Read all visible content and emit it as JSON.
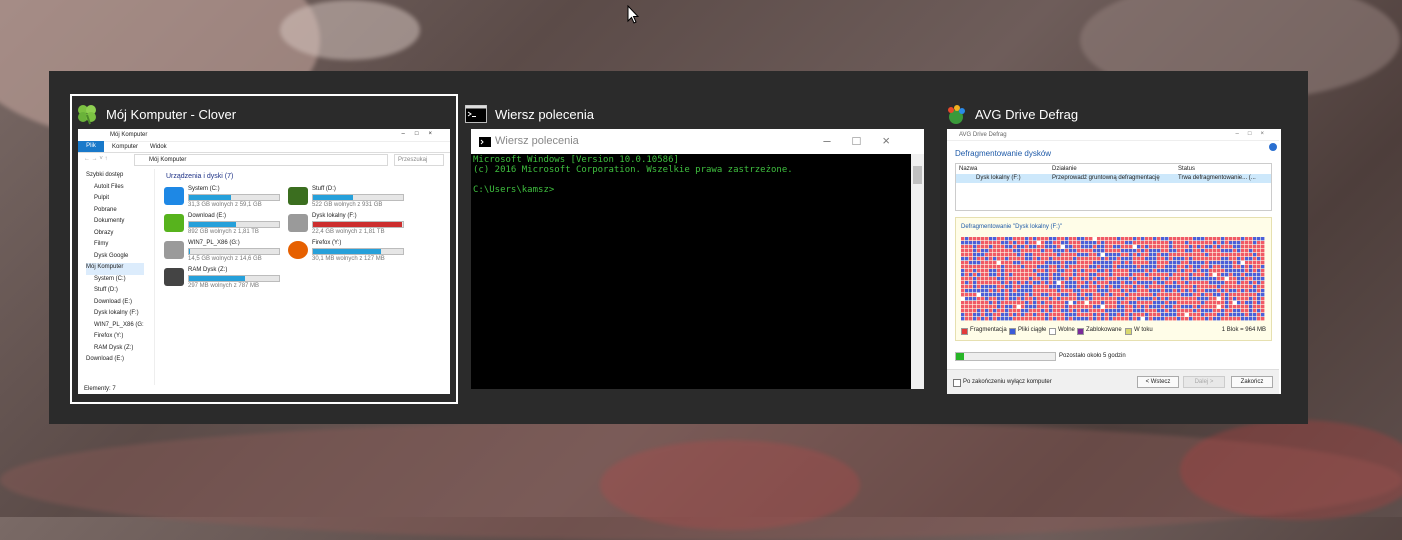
{
  "colors": {
    "accent": "#26a0da",
    "danger": "#cc2e2e",
    "console_text": "#3fbf3f",
    "panel": "#2b2b2b",
    "frag": "#f05a66",
    "contig": "#4c5fd8"
  },
  "windows": [
    {
      "title": "Mój Komputer - Clover",
      "icon": "clover-icon",
      "explorer": {
        "tab_title": "Mój Komputer",
        "ribbon": [
          "Plik",
          "Komputer",
          "Widok"
        ],
        "address": "Mój Komputer",
        "search_placeholder": "Przeszukaj",
        "section": "Urządzenia i dyski (7)",
        "nav": [
          "Szybki dostęp",
          "Autoit Files",
          "Pulpit",
          "Pobrane",
          "Dokumenty",
          "Obrazy",
          "Filmy",
          "Dysk Google",
          "Mój Komputer",
          "System (C:)",
          "Stuff (D:)",
          "Download (E:)",
          "Dysk lokalny (F:)",
          "WIN7_PL_X86 (G:",
          "Firefox (Y:)",
          "RAM Dysk (Z:)",
          "Download (E:)"
        ],
        "drives": [
          {
            "name": "System (C:)",
            "free": "31,3 GB wolnych z 59,1 GB",
            "fill": 0.47,
            "bar": "#26a0da",
            "icon": "windows-drive-icon"
          },
          {
            "name": "Stuff (D:)",
            "free": "522 GB wolnych z 931 GB",
            "fill": 0.44,
            "bar": "#26a0da",
            "icon": "leaf-drive-icon"
          },
          {
            "name": "Download (E:)",
            "free": "892 GB wolnych z 1,81 TB",
            "fill": 0.52,
            "bar": "#26a0da",
            "icon": "green-drive-icon"
          },
          {
            "name": "Dysk lokalny (F:)",
            "free": "22,4 GB wolnych z 1,81 TB",
            "fill": 0.99,
            "bar": "#cc2e2e",
            "icon": "hard-drive-icon"
          },
          {
            "name": "WIN7_PL_X86 (G:)",
            "free": "14,5 GB wolnych z 14,6 GB",
            "fill": 0.01,
            "bar": "#26a0da",
            "icon": "hard-drive-icon"
          },
          {
            "name": "Firefox (Y:)",
            "free": "30,1 MB wolnych z 127 MB",
            "fill": 0.76,
            "bar": "#26a0da",
            "icon": "firefox-icon"
          },
          {
            "name": "RAM Dysk (Z:)",
            "free": "297 MB wolnych z 787 MB",
            "fill": 0.62,
            "bar": "#26a0da",
            "icon": "ram-drive-icon"
          }
        ],
        "status": "Elementy: 7"
      }
    },
    {
      "title": "Wiersz polecenia",
      "icon": "cmd-icon",
      "console": {
        "window_title": "Wiersz polecenia",
        "lines": [
          "Microsoft Windows [Version 10.0.10586]",
          "(c) 2016 Microsoft Corporation. Wszelkie prawa zastrzeżone.",
          "",
          "C:\\Users\\kamsz>"
        ]
      }
    },
    {
      "title": "AVG Drive Defrag",
      "icon": "avg-icon",
      "avg": {
        "window_title": "AVG Drive Defrag",
        "heading": "Defragmentowanie dysków",
        "columns": [
          "Nazwa",
          "Działanie",
          "Status"
        ],
        "row": [
          "Dysk lokalny (F:)",
          "Przeprowadź gruntowną defragmentację",
          "Trwa defragmentowanie... (..."
        ],
        "map_title": "Defragmentowanie \"Dysk lokalny (F:)\"",
        "legend": [
          {
            "label": "Fragmentacja",
            "color": "#e23b3b"
          },
          {
            "label": "Pliki ciągłe",
            "color": "#3b5bd8"
          },
          {
            "label": "Wolne",
            "color": "#ffffff"
          },
          {
            "label": "Zablokowane",
            "color": "#7a2a9a"
          },
          {
            "label": "W toku",
            "color": "#d8d870"
          }
        ],
        "block_info": "1 Blok = 964 MB",
        "progress": 0.08,
        "remaining": "Pozostało około 5 godzin",
        "checkbox_label": "Po zakończeniu wyłącz komputer",
        "buttons": [
          "< Wstecz",
          "Dalej >",
          "Zakończ"
        ]
      }
    }
  ]
}
